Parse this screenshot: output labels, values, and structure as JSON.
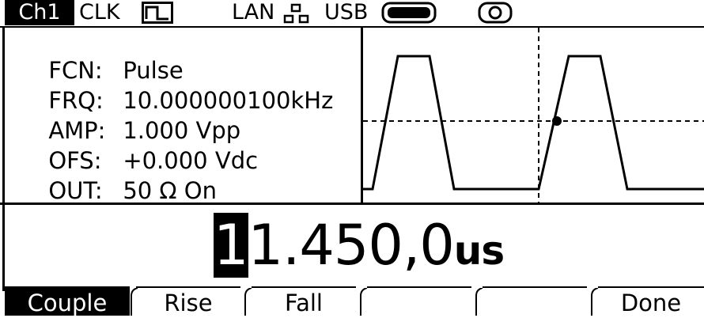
{
  "status_bar": {
    "channel": "Ch1",
    "clk_label": "CLK",
    "lan_label": "LAN",
    "usb_label": "USB",
    "icons": [
      "clock-pulse-icon",
      "lan-network-icon",
      "usb-memory-icon",
      "disk-icon"
    ]
  },
  "params": {
    "fcn_label": "FCN:",
    "fcn_value": "Pulse",
    "frq_label": "FRQ:",
    "frq_value": "10.000000100kHz",
    "amp_label": "AMP:",
    "amp_value": "1.000 Vpp",
    "ofs_label": "OFS:",
    "ofs_value": "+0.000 Vdc",
    "out_label": "OUT:",
    "out_value": "50 Ω On"
  },
  "edit_value": {
    "cursor_digit": "1",
    "rest": "1.450,0",
    "unit": "us"
  },
  "softkeys": [
    {
      "label": "Couple",
      "active": true
    },
    {
      "label": "Rise",
      "active": false
    },
    {
      "label": "Fall",
      "active": false
    },
    {
      "label": "",
      "active": false
    },
    {
      "label": "",
      "active": false
    },
    {
      "label": "Done",
      "active": false
    }
  ],
  "colors": {
    "foreground": "#000000",
    "background": "#ffffff"
  }
}
